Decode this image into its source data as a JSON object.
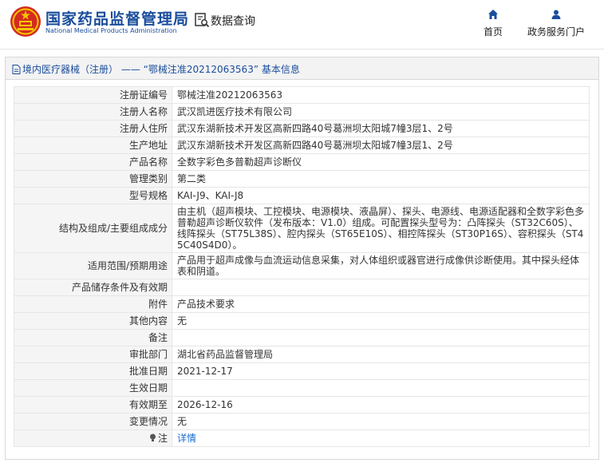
{
  "header": {
    "brand_cn": "国家药品监督管理局",
    "brand_en": "National Medical Products Administration",
    "query_label": "数据查询",
    "nav_home": "首页",
    "nav_portal": "政务服务门户"
  },
  "panel": {
    "title": "境内医疗器械（注册） —— “鄂械注准20212063563” 基本信息"
  },
  "rows": [
    {
      "label": "注册证编号",
      "value": "鄂械注准20212063563"
    },
    {
      "label": "注册人名称",
      "value": "武汉凯进医疗技术有限公司"
    },
    {
      "label": "注册人住所",
      "value": "武汉东湖新技术开发区高新四路40号葛洲坝太阳城7幢3层1、2号"
    },
    {
      "label": "生产地址",
      "value": "武汉东湖新技术开发区高新四路40号葛洲坝太阳城7幢3层1、2号"
    },
    {
      "label": "产品名称",
      "value": "全数字彩色多普勒超声诊断仪"
    },
    {
      "label": "管理类别",
      "value": "第二类"
    },
    {
      "label": "型号规格",
      "value": "KAI-J9、KAI-J8"
    },
    {
      "label": "结构及组成/主要组成成分",
      "value": "由主机（超声模块、工控模块、电源模块、液晶屏）、探头、电源线、电源适配器和全数字彩色多普勒超声诊断仪软件（发布版本：V1.0）组成。可配置探头型号为：凸阵探头（ST32C60S）、线阵探头（ST75L38S）、腔内探头（ST65E10S）、相控阵探头（ST30P16S）、容积探头（ST45C40S4D0）。"
    },
    {
      "label": "适用范围/预期用途",
      "value": "产品用于超声成像与血流运动信息采集，对人体组织或器官进行成像供诊断使用。其中探头经体表和阴道。"
    },
    {
      "label": "产品储存条件及有效期",
      "value": ""
    },
    {
      "label": "附件",
      "value": "产品技术要求"
    },
    {
      "label": "其他内容",
      "value": "无"
    },
    {
      "label": "备注",
      "value": ""
    },
    {
      "label": "审批部门",
      "value": "湖北省药品监督管理局"
    },
    {
      "label": "批准日期",
      "value": "2021-12-17"
    },
    {
      "label": "生效日期",
      "value": ""
    },
    {
      "label": "有效期至",
      "value": "2026-12-16"
    },
    {
      "label": "变更情况",
      "value": "无"
    },
    {
      "label": "注",
      "value": "详情"
    }
  ],
  "colors": {
    "brand_blue": "#1a4d9c",
    "link_blue": "#1a6bd1",
    "emblem_red": "#d42b1e",
    "emblem_gold": "#f5c400"
  },
  "icons": {
    "emblem": "national-emblem-icon",
    "query": "search-document-icon",
    "home": "home-icon",
    "portal": "user-icon",
    "title": "document-icon",
    "note": "bulb-icon"
  }
}
